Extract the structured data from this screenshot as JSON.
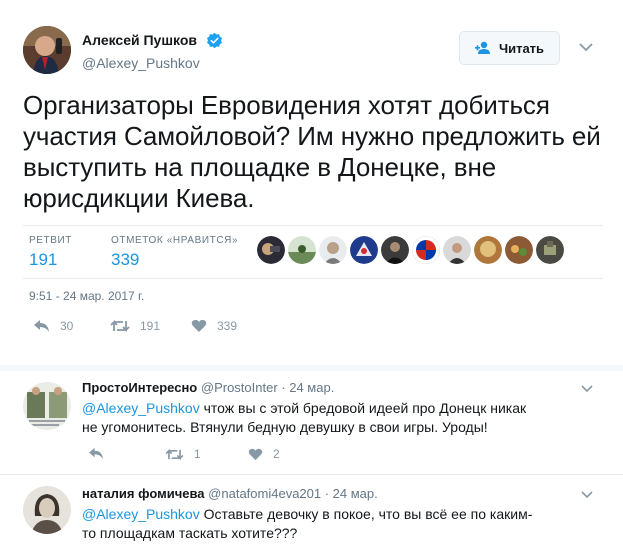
{
  "tweet": {
    "author_name": "Алексей Пушков",
    "author_handle": "@Alexey_Pushkov",
    "follow_label": "Читать",
    "text": "Организаторы Евровидения хотят добиться участия Самойловой? Им нужно предложить ей выступить на площадке в Донецке, вне юрисдикции Киева.",
    "retweets_label": "РЕТВИТ",
    "retweets_count": "191",
    "likes_label": "ОТМЕТОК «НРАВИТСЯ»",
    "likes_count": "339",
    "timestamp": "9:51 - 24 мар. 2017 г.",
    "actions": {
      "reply_count": "30",
      "retweet_count": "191",
      "like_count": "339"
    },
    "icons": {
      "verified": "verified-badge-icon",
      "follow": "add-user-icon",
      "more": "chevron-down-icon"
    },
    "accent_color": "#1b95e0"
  },
  "replies": [
    {
      "name": "ПростоИнтересно",
      "handle": "@ProstoInter",
      "date": "· 24 мар.",
      "mention": "@Alexey_Pushkov",
      "text": " чтож вы с этой бредовой идеей про Донецк никак не угомонитесь. Втянули бедную девушку в свои игры. Уроды!",
      "reply_count": "",
      "retweet_count": "1",
      "like_count": "2"
    },
    {
      "name": "наталия фомичева",
      "handle": "@natafomi4eva201",
      "date": "· 24 мар.",
      "mention": "@Alexey_Pushkov",
      "text": " Оставьте девочку в покое, что вы всё ее по каким-то площадкам таскать хотите???"
    }
  ]
}
